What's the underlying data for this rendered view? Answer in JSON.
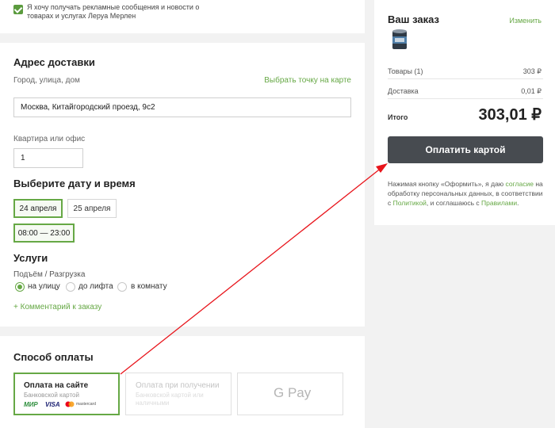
{
  "consent": {
    "checked": true,
    "text": "Я хочу получать рекламные сообщения и новости о товарах и услугах Леруа Мерлен"
  },
  "delivery": {
    "title": "Адрес доставки",
    "address_label": "Город, улица, дом",
    "map_link": "Выбрать точку на карте",
    "address_value": "Москва, Китайгородский проезд, 9с2",
    "apartment_label": "Квартира или офис",
    "apartment_value": "1",
    "date_title": "Выберите дату и время",
    "dates": [
      "24 апреля",
      "25 апреля"
    ],
    "selected_date": "24 апреля",
    "time_slot": "08:00 — 23:00",
    "services_title": "Услуги",
    "lift_label": "Подъём / Разгрузка",
    "lift_options": [
      "на улицу",
      "до лифта",
      "в комнату"
    ],
    "lift_selected": "на улицу",
    "comment_link": "+ Комментарий к заказу"
  },
  "payment": {
    "title": "Способ оплаты",
    "options": [
      {
        "title": "Оплата на сайте",
        "subtitle": "Банковской картой",
        "selected": true
      },
      {
        "title": "Оплата при получении",
        "subtitle": "Банковской картой или наличными",
        "selected": false
      },
      {
        "title": "G Pay",
        "subtitle": "",
        "selected": false
      }
    ],
    "card_logos": [
      "МИР",
      "VISA",
      "mastercard"
    ]
  },
  "order": {
    "title": "Ваш заказ",
    "edit_link": "Изменить",
    "goods_label": "Товары (1)",
    "goods_value": "303 ₽",
    "delivery_label": "Доставка",
    "delivery_value": "0,01 ₽",
    "total_label": "Итого",
    "total_value": "303,01 ₽",
    "pay_button": "Оплатить картой",
    "legal": {
      "p1": "Нажимая кнопку «Оформить», я даю ",
      "link1": "согласие",
      "p2": " на обработку персональных данных, в соответствии с ",
      "link2": "Политикой",
      "p3": ", и соглашаюсь с ",
      "link3": "Правилами",
      "p4": "."
    }
  },
  "colors": {
    "accent": "#66a845",
    "button": "#474b50",
    "annotation_arrow": "#e8141b"
  }
}
